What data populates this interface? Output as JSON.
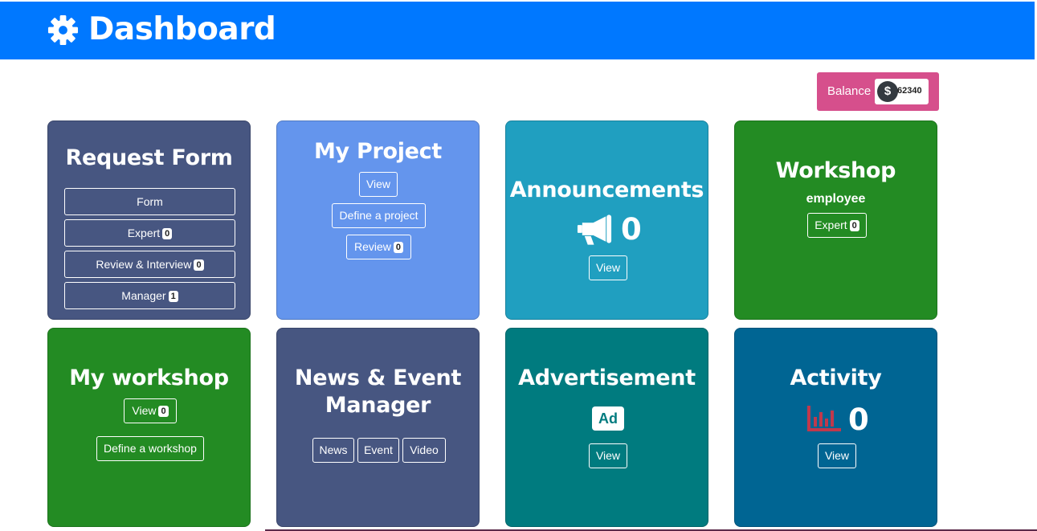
{
  "header": {
    "title": "Dashboard"
  },
  "balance": {
    "label": "Balance",
    "currency_symbol": "$",
    "amount": "62340"
  },
  "colors": {
    "header": "#0078ff",
    "balance": "#d64f8c",
    "slate": "#475681",
    "cornflower": "#6495ed",
    "cyan": "#209fc0",
    "green": "#238b23",
    "teal": "#007b7f",
    "darkblue": "#006593",
    "chart_icon": "#c0394c"
  },
  "cards": {
    "request_form": {
      "title": "Request Form",
      "buttons": [
        {
          "label": "Form",
          "badge": null
        },
        {
          "label": "Expert",
          "badge": "0"
        },
        {
          "label": "Review & Interview",
          "badge": "0"
        },
        {
          "label": "Manager",
          "badge": "1"
        }
      ]
    },
    "my_project": {
      "title": "My Project",
      "view": "View",
      "define": "Define a project",
      "review": {
        "label": "Review",
        "badge": "0"
      }
    },
    "announcements": {
      "title": "Announcements",
      "icon": "megaphone-icon",
      "count": "0",
      "view": "View"
    },
    "workshop": {
      "title": "Workshop",
      "subtitle": "employee",
      "expert": {
        "label": "Expert",
        "badge": "0"
      }
    },
    "my_workshop": {
      "title": "My workshop",
      "view": {
        "label": "View",
        "badge": "0"
      },
      "define": "Define a workshop"
    },
    "news_event": {
      "title_line1": "News & Event",
      "title_line2": "Manager",
      "buttons": [
        "News",
        "Event",
        "Video"
      ]
    },
    "advertisement": {
      "title": "Advertisement",
      "icon_text": "Ad",
      "view": "View"
    },
    "activity": {
      "title": "Activity",
      "icon": "bar-chart-icon",
      "count": "0",
      "view": "View"
    }
  }
}
